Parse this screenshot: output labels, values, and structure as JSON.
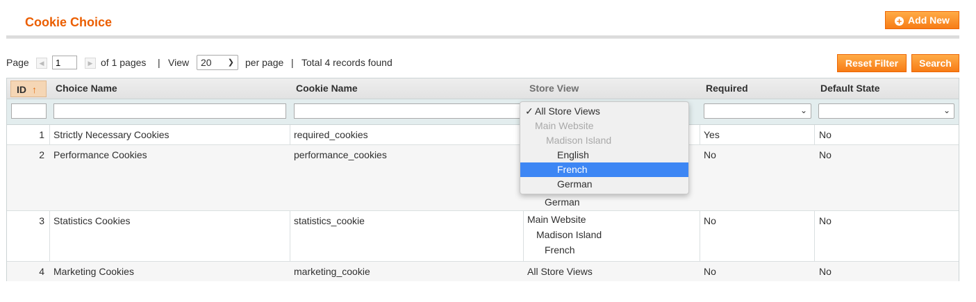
{
  "header": {
    "title": "Cookie Choice",
    "add_new_label": "Add New"
  },
  "pager": {
    "page_label": "Page",
    "page_value": "1",
    "of_pages": "of 1 pages",
    "sep1": "|",
    "view_label": "View",
    "view_value": "20",
    "per_page": "per page",
    "sep2": "|",
    "total": "Total 4 records found"
  },
  "actions": {
    "reset_filter": "Reset Filter",
    "search": "Search"
  },
  "columns": {
    "id": "ID",
    "choice_name": "Choice Name",
    "cookie_name": "Cookie Name",
    "store_view": "Store View",
    "required": "Required",
    "default_state": "Default State"
  },
  "rows": [
    {
      "id": "1",
      "choice_name": "Strictly Necessary Cookies",
      "cookie_name": "required_cookies",
      "store_view": [],
      "required": "Yes",
      "default_state": "No"
    },
    {
      "id": "2",
      "choice_name": "Performance Cookies",
      "cookie_name": "performance_cookies",
      "store_view": [
        "German"
      ],
      "required": "No",
      "default_state": "No"
    },
    {
      "id": "3",
      "choice_name": "Statistics Cookies",
      "cookie_name": "statistics_cookie",
      "store_view": [
        "Main Website",
        "Madison Island",
        "French"
      ],
      "required": "No",
      "default_state": "No"
    },
    {
      "id": "4",
      "choice_name": "Marketing Cookies",
      "cookie_name": "marketing_cookie",
      "store_view": [
        "All Store Views"
      ],
      "required": "No",
      "default_state": "No"
    }
  ],
  "store_view_dropdown": {
    "options": [
      {
        "label": "All Store Views",
        "checked": true
      },
      {
        "label": "Main Website",
        "disabled": true
      },
      {
        "label": "Madison Island",
        "disabled": true
      },
      {
        "label": "English"
      },
      {
        "label": "French",
        "highlighted": true
      },
      {
        "label": "German"
      }
    ]
  },
  "icons": {
    "checkmark": "✓",
    "sort_asc": "↑",
    "chevron": "chevron-down-icon",
    "plus": "plus-circle-icon"
  },
  "colors": {
    "accent": "#eb5e00",
    "button": "#f77c16",
    "highlight": "#3d86f4"
  }
}
